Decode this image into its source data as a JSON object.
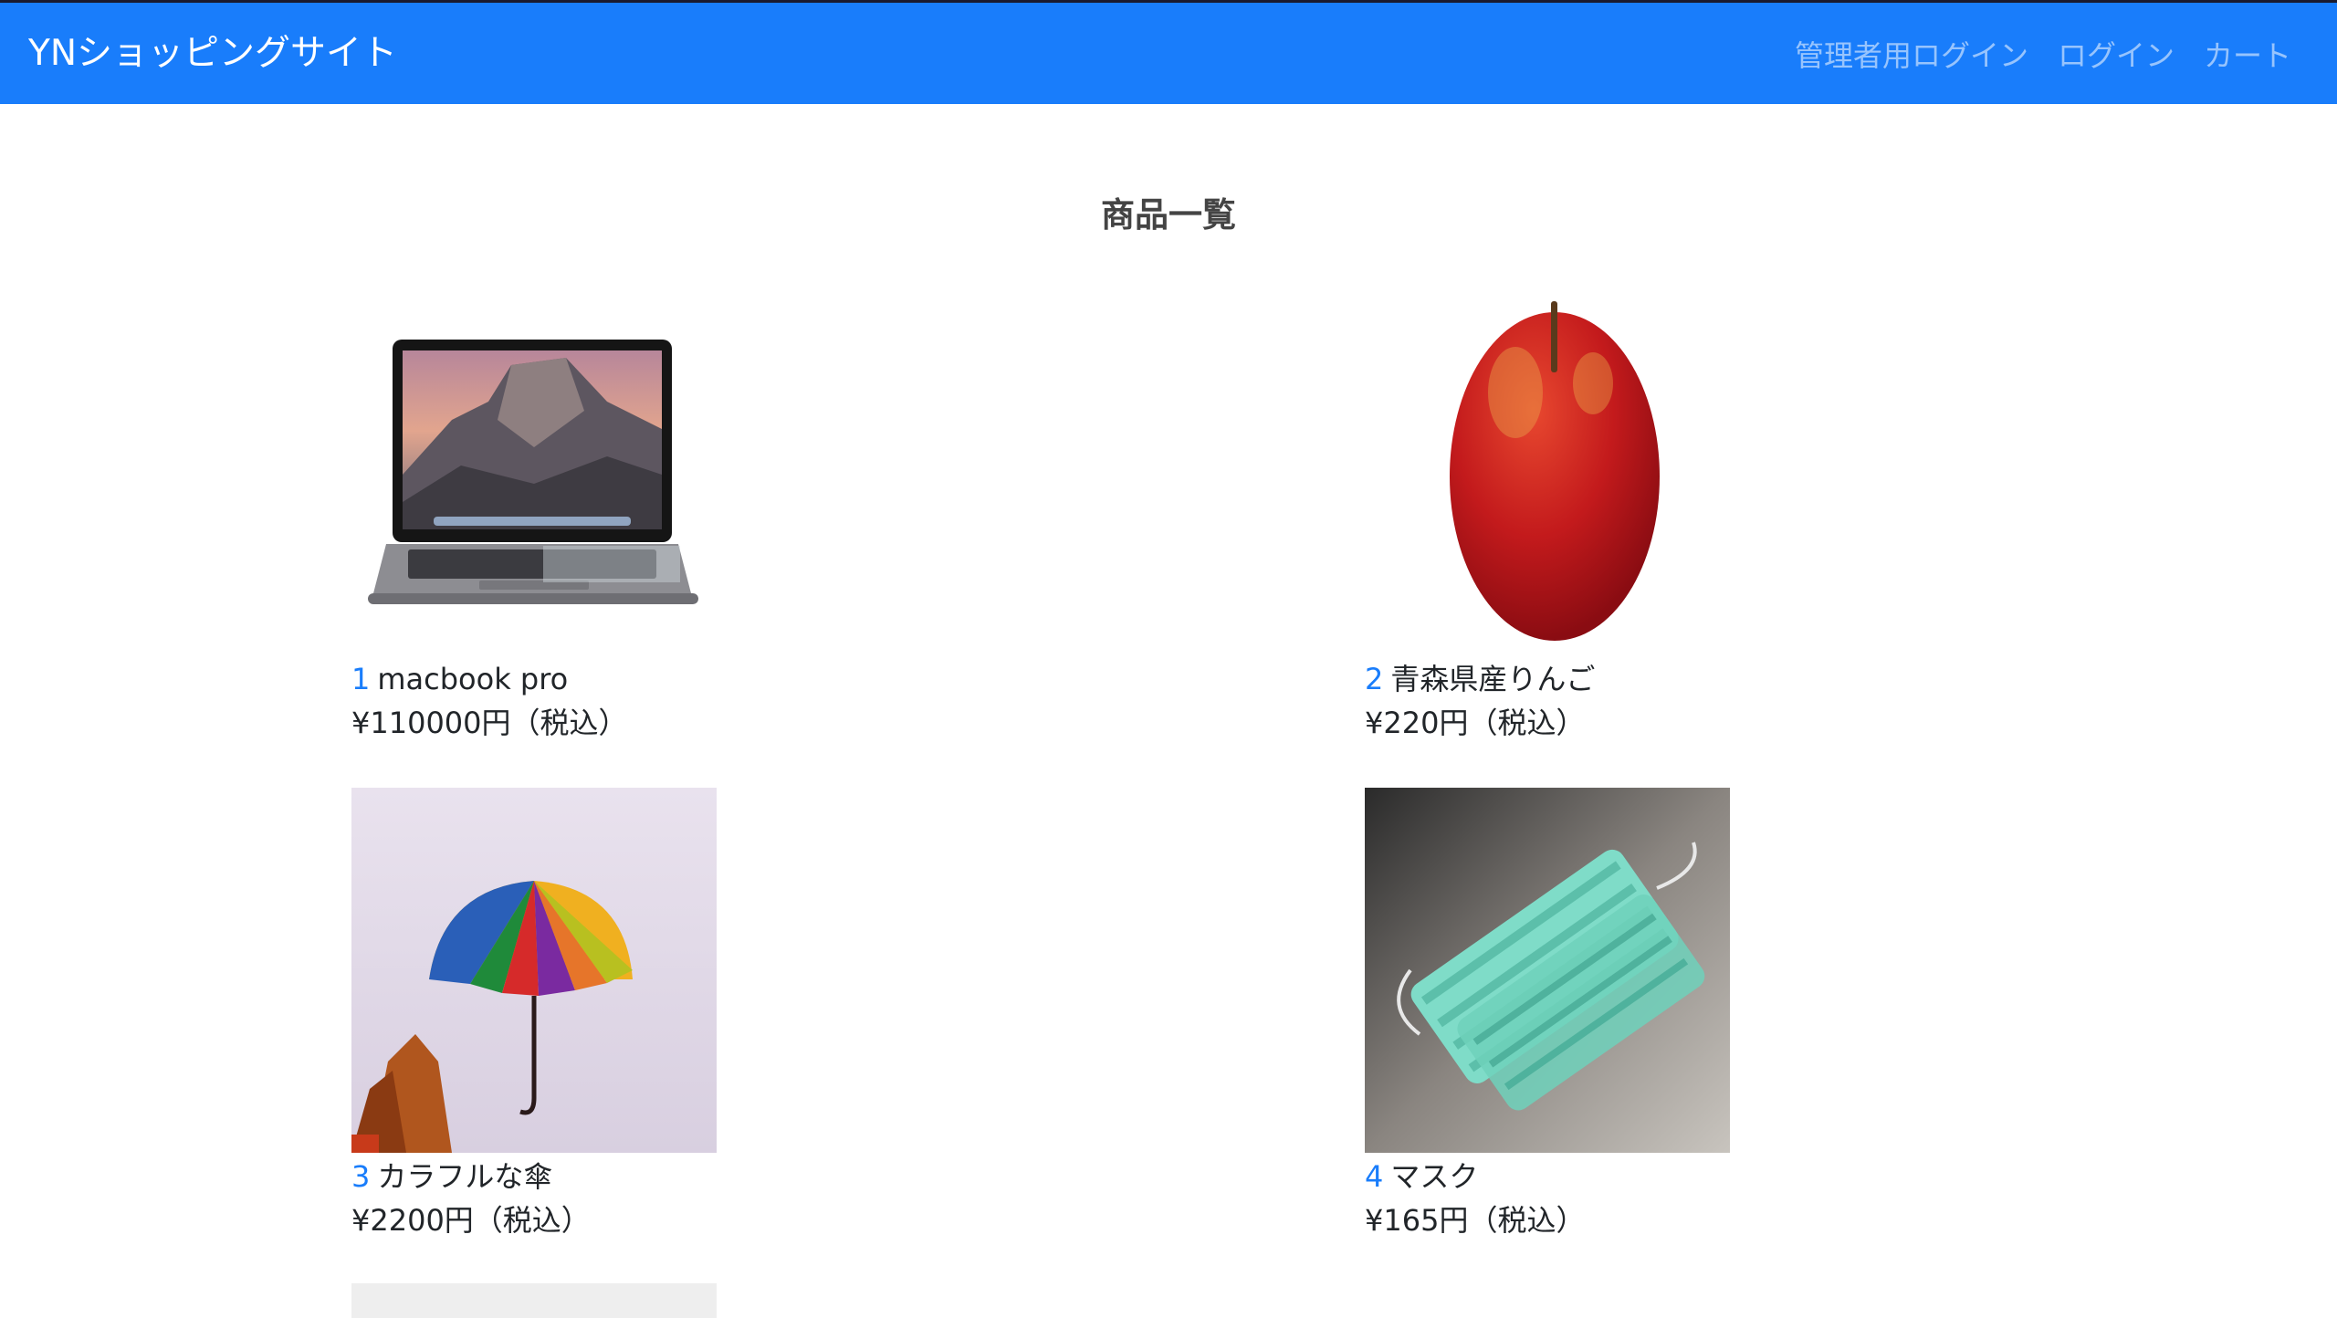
{
  "navbar": {
    "brand": "YNショッピングサイト",
    "links": [
      "管理者用ログイン",
      "ログイン",
      "カート"
    ],
    "color": "#197dfb"
  },
  "page": {
    "title": "商品一覧"
  },
  "products": [
    {
      "id": "1",
      "name": "macbook pro",
      "price": "¥110000円（税込）",
      "image": "laptop"
    },
    {
      "id": "2",
      "name": "青森県産りんご",
      "price": "¥220円（税込）",
      "image": "apple"
    },
    {
      "id": "3",
      "name": "カラフルな傘",
      "price": "¥2200円（税込）",
      "image": "umbrella"
    },
    {
      "id": "4",
      "name": "マスク",
      "price": "¥165円（税込）",
      "image": "masks"
    }
  ]
}
